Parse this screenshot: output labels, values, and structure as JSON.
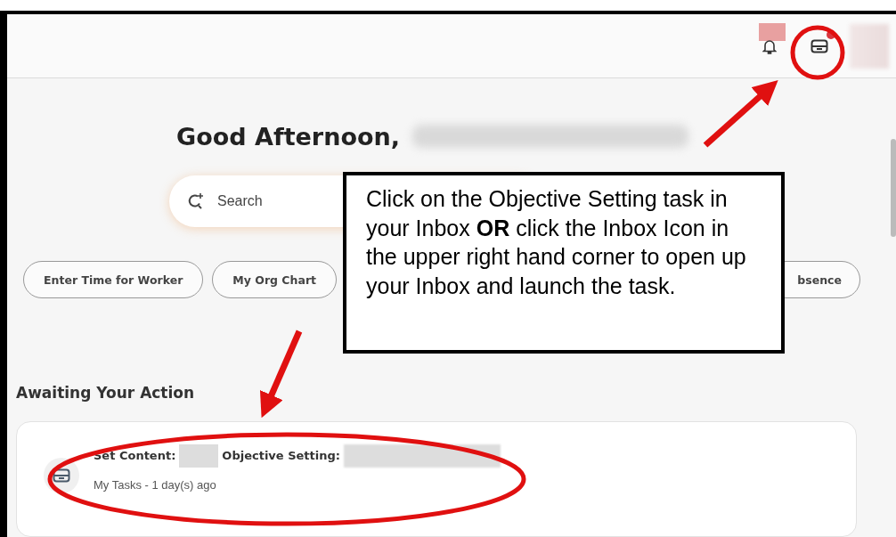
{
  "greeting": {
    "text": "Good Afternoon,"
  },
  "search": {
    "placeholder": "Search"
  },
  "chips": [
    {
      "label": "Enter Time for Worker"
    },
    {
      "label": "My Org Chart"
    },
    {
      "label": "bsence"
    }
  ],
  "callout": {
    "text": "Click on the Objective Setting task in your Inbox **OR** click the Inbox Icon in the upper right hand corner to open up your Inbox and launch the task."
  },
  "section": {
    "title": "Awaiting Your Action"
  },
  "tasks": [
    {
      "parts": [
        {
          "label": "Set Content:"
        },
        {
          "label": "Objective Setting:"
        }
      ],
      "subtitle": "My Tasks - 1 day(s) ago"
    }
  ]
}
